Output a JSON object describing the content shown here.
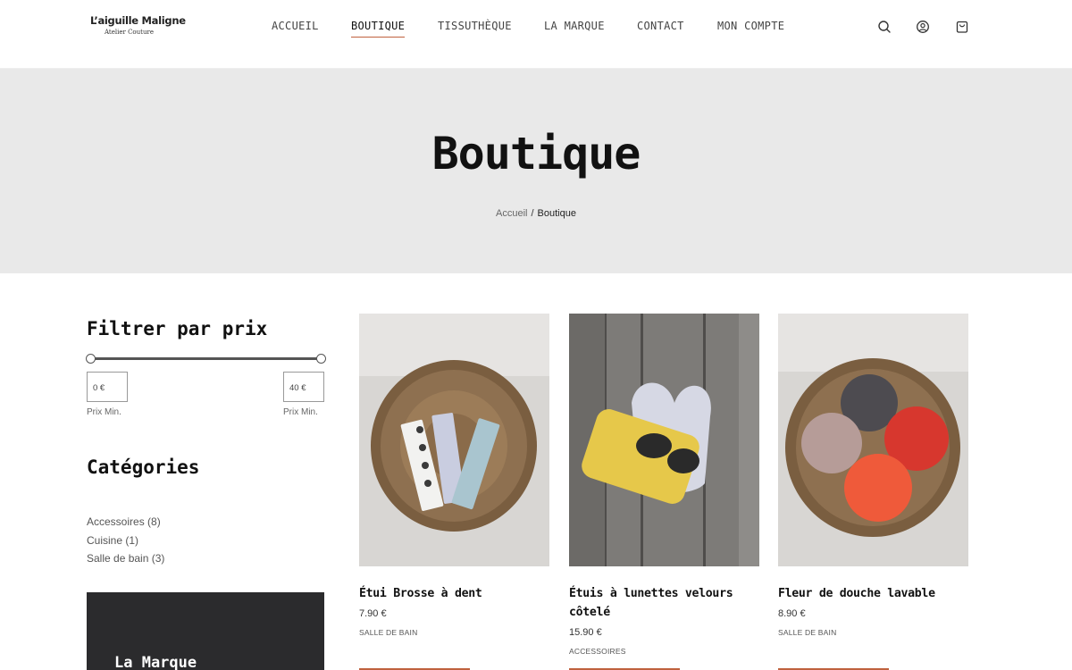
{
  "header": {
    "logo_name": "L’aiguille Maligne",
    "logo_sub": "Atelier Couture",
    "nav": [
      {
        "label": "ACCUEIL",
        "active": false
      },
      {
        "label": "BOUTIQUE",
        "active": true
      },
      {
        "label": "TISSUTHÈQUE",
        "active": false
      },
      {
        "label": "LA MARQUE",
        "active": false
      },
      {
        "label": "CONTACT",
        "active": false
      },
      {
        "label": "MON COMPTE",
        "active": false
      }
    ],
    "icons": [
      "search-icon",
      "account-icon",
      "cart-icon"
    ]
  },
  "hero": {
    "title": "Boutique",
    "breadcrumb_home": "Accueil",
    "breadcrumb_sep": "/",
    "breadcrumb_current": "Boutique"
  },
  "sidebar": {
    "price_filter_title": "Filtrer par prix",
    "min_value": "0 €",
    "max_value": "40 €",
    "min_label": "Prix Min.",
    "max_label": "Prix Min.",
    "categories_title": "Catégories",
    "categories": [
      {
        "label": "Accessoires (8)"
      },
      {
        "label": "Cuisine (1)"
      },
      {
        "label": "Salle de bain (3)"
      }
    ],
    "brand_box_title": "La Marque"
  },
  "products": [
    {
      "title": "Étui Brosse à dent",
      "price": "7.90 €",
      "category": "SALLE DE BAIN"
    },
    {
      "title": "Étuis à lunettes velours côtelé",
      "price": "15.90 €",
      "category": "ACCESSOIRES"
    },
    {
      "title": "Fleur de douche lavable",
      "price": "8.90 €",
      "category": "SALLE DE BAIN"
    }
  ],
  "colors": {
    "accent": "#c0623e",
    "hero_bg": "#e9e9e9",
    "dark_box": "#2b2b2d"
  }
}
